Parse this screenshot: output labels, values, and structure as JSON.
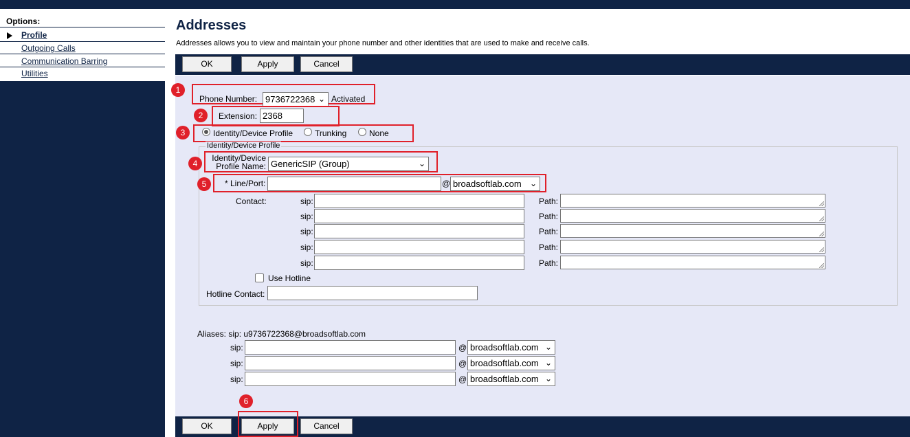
{
  "sidebar": {
    "title": "Options:",
    "items": [
      {
        "label": "Profile",
        "active": true
      },
      {
        "label": "Outgoing Calls"
      },
      {
        "label": "Communication Barring"
      },
      {
        "label": "Utilities"
      }
    ]
  },
  "page": {
    "title": "Addresses",
    "description": "Addresses allows you to view and maintain your phone number and other identities that are used to make and receive calls."
  },
  "buttons": {
    "ok": "OK",
    "apply": "Apply",
    "cancel": "Cancel"
  },
  "form": {
    "phone_number_label": "Phone Number:",
    "phone_number_value": "9736722368",
    "phone_status": "Activated",
    "extension_label": "Extension:",
    "extension_value": "2368",
    "mode_options": [
      "Identity/Device Profile",
      "Trunking",
      "None"
    ],
    "mode_selected": "Identity/Device Profile",
    "fieldset_legend": "Identity/Device Profile",
    "profile_name_label_1": "Identity/Device",
    "profile_name_label_2": "Profile Name:",
    "profile_name_value": "GenericSIP (Group)",
    "line_port_label": "* Line/Port:",
    "line_port_value": "",
    "at": "@",
    "domain": "broadsoftlab.com",
    "contact_label": "Contact:",
    "sip_label": "sip:",
    "path_label": "Path:",
    "use_hotline_label": "Use Hotline",
    "hotline_contact_label": "Hotline Contact:",
    "aliases_label": "Aliases: sip: u9736722368@broadsoftlab.com"
  },
  "markers": [
    "1",
    "2",
    "3",
    "4",
    "5",
    "6"
  ],
  "colors": {
    "navy": "#0f2345",
    "panel": "#e6e8f7",
    "annotation": "#e0202a"
  }
}
